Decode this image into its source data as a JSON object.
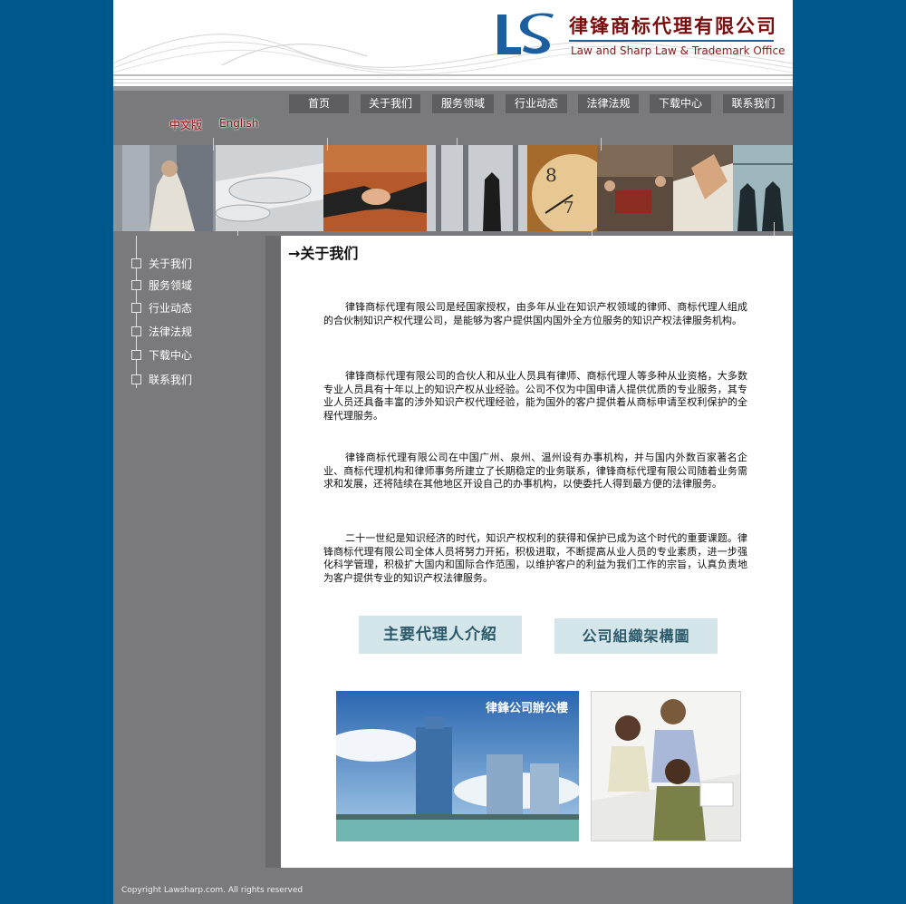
{
  "header": {
    "logo_mark": "LS",
    "company_cn": "律锋商标代理有限公司",
    "company_en": "Law and Sharp Law & Trademark Office"
  },
  "nav": {
    "items": [
      "首页",
      "关于我们",
      "服务领域",
      "行业动态",
      "法律法规",
      "下载中心",
      "联系我们"
    ]
  },
  "language": {
    "chinese": "中文版",
    "english": "English"
  },
  "sidebar": {
    "items": [
      "关于我们",
      "服务领域",
      "行业动态",
      "法律法规",
      "下载中心",
      "联系我们"
    ]
  },
  "content": {
    "title": "→关于我们",
    "paragraphs": [
      "律锋商标代理有限公司是经国家授权，由多年从业在知识产权领域的律师、商标代理人组成的合伙制知识产权代理公司，是能够为客户提供国内国外全方位服务的知识产权法律服务机构。",
      "律锋商标代理有限公司的合伙人和从业人员具有律师、商标代理人等多种从业资格，大多数专业人员具有十年以上的知识产权从业经验。公司不仅为中国申请人提供优质的专业服务，其专业人员还具备丰富的涉外知识产权代理经验，能为国外的客户提供着从商标申请至权利保护的全程代理服务。",
      "律锋商标代理有限公司在中国广州、泉州、温州设有办事机构，并与国内外数百家著名企业、商标代理机构和律师事务所建立了长期稳定的业务联系，律锋商标代理有限公司随着业务需求和发展，还将陆续在其他地区开设自己的办事机构，以使委托人得到最方便的法律服务。",
      "二十一世纪是知识经济的时代，知识产权权利的获得和保护已成为这个时代的重要课题。律锋商标代理有限公司全体人员将努力开拓，积极进取，不断提高从业人员的专业素质，进一步强化科学管理，积极扩大国内和国际合作范围，以维护客户的利益为我们工作的宗旨，认真负责地为客户提供专业的知识产权法律服务。"
    ],
    "button_agents": "主要代理人介紹",
    "button_org": "公司組織架構圖",
    "photo_building_label": "律鋒公司辦公樓"
  },
  "footer": {
    "copyright": "Copyright  Lawsharp.com. All rights reserved"
  },
  "colors": {
    "background": "#00578c",
    "panel": "#7a797b",
    "nav_button": "#5e5d60",
    "logo_blue": "#1b5fa0",
    "logo_red": "#7a0e0e"
  }
}
